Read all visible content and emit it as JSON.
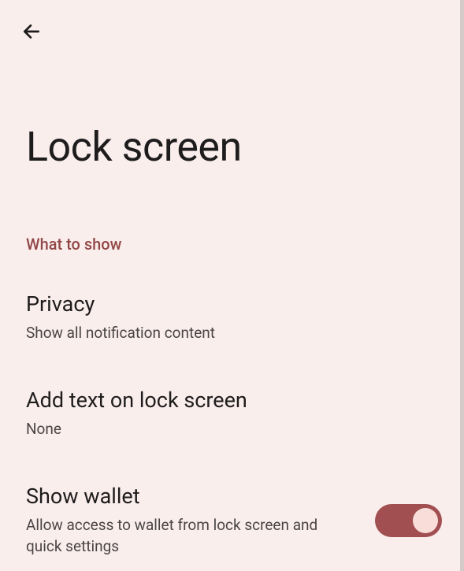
{
  "header": {
    "title": "Lock screen"
  },
  "section": {
    "label": "What to show"
  },
  "settings": {
    "privacy": {
      "title": "Privacy",
      "subtitle": "Show all notification content"
    },
    "add_text": {
      "title": "Add text on lock screen",
      "subtitle": "None"
    },
    "show_wallet": {
      "title": "Show wallet",
      "subtitle": "Allow access to wallet from lock screen and quick settings",
      "enabled": true
    }
  }
}
